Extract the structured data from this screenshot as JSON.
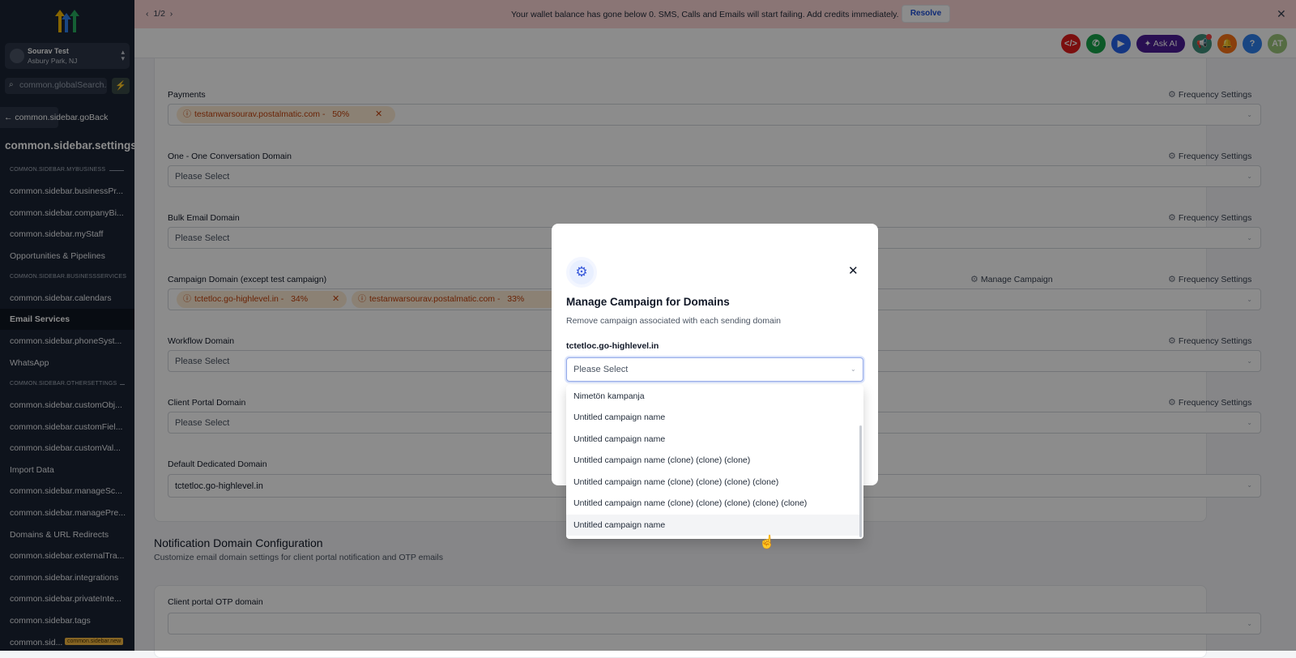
{
  "account": {
    "name": "Sourav Test",
    "location": "Asbury Park, NJ"
  },
  "sidebar": {
    "search_placeholder": "common.globalSearch.sidebar",
    "go_back": "common.sidebar.goBack",
    "title": "common.sidebar.settings",
    "sections": {
      "my_business": "COMMON.SIDEBAR.MYBUSINESS",
      "business_services": "COMMON.SIDEBAR.BUSINESSSERVICES",
      "other_settings": "COMMON.SIDEBAR.OTHERSETTINGS"
    },
    "items": [
      "common.sidebar.businessPr...",
      "common.sidebar.companyBi...",
      "common.sidebar.myStaff",
      "Opportunities & Pipelines",
      "common.sidebar.calendars",
      "Email Services",
      "common.sidebar.phoneSyst...",
      "WhatsApp",
      "common.sidebar.customObj...",
      "common.sidebar.customFiel...",
      "common.sidebar.customVal...",
      "Import Data",
      "common.sidebar.manageSc...",
      "common.sidebar.managePre...",
      "Domains & URL Redirects",
      "common.sidebar.externalTra...",
      "common.sidebar.integrations",
      "common.sidebar.privateInte...",
      "common.sidebar.tags",
      "common.sid..."
    ],
    "new_badge": "common.sidebar.new",
    "active_item": "Email Services"
  },
  "banner": {
    "pager": "1/2",
    "message": "Your wallet balance has gone below 0. SMS, Calls and Emails will start failing. Add credits immediately.",
    "resolve_label": "Resolve"
  },
  "header": {
    "ask_ai": "Ask AI",
    "avatar": "AT",
    "help": "?"
  },
  "form": {
    "frequency_label": "Frequency Settings",
    "manage_campaign_label": "Manage Campaign",
    "placeholder": "Please Select",
    "fields": {
      "payments": {
        "label": "Payments",
        "chips": [
          {
            "text": "testanwarsourav.postalmatic.com -",
            "pct": "50%"
          }
        ]
      },
      "one_one": {
        "label": "One - One Conversation Domain"
      },
      "bulk": {
        "label": "Bulk Email Domain"
      },
      "campaign": {
        "label": "Campaign Domain (except test campaign)",
        "chips": [
          {
            "text": "tctetloc.go-highlevel.in -",
            "pct": "34%"
          },
          {
            "text": "testanwarsourav.postalmatic.com -",
            "pct": "33%"
          }
        ]
      },
      "workflow": {
        "label": "Workflow Domain"
      },
      "client_portal": {
        "label": "Client Portal Domain"
      },
      "default_dedicated": {
        "label": "Default Dedicated Domain",
        "value": "tctetloc.go-highlevel.in"
      }
    }
  },
  "notification": {
    "title": "Notification Domain Configuration",
    "subtitle": "Customize email domain settings for client portal notification and OTP emails",
    "otp_label": "Client portal OTP domain"
  },
  "modal": {
    "title": "Manage Campaign for Domains",
    "subtitle": "Remove campaign associated with each sending domain",
    "domain": "tctetloc.go-highlevel.in",
    "select_placeholder": "Please Select",
    "options": [
      "Nimetön kampanja",
      "Untitled campaign name",
      "Untitled campaign name",
      "Untitled campaign name (clone) (clone) (clone)",
      "Untitled campaign name (clone) (clone) (clone) (clone)",
      "Untitled campaign name (clone) (clone) (clone) (clone) (clone)",
      "Untitled campaign name"
    ]
  },
  "colors": {
    "sidebar": "#1b2434",
    "banner": "#fbd5d5",
    "chip": "#fdebd3",
    "accent": "#3b5bdb"
  }
}
